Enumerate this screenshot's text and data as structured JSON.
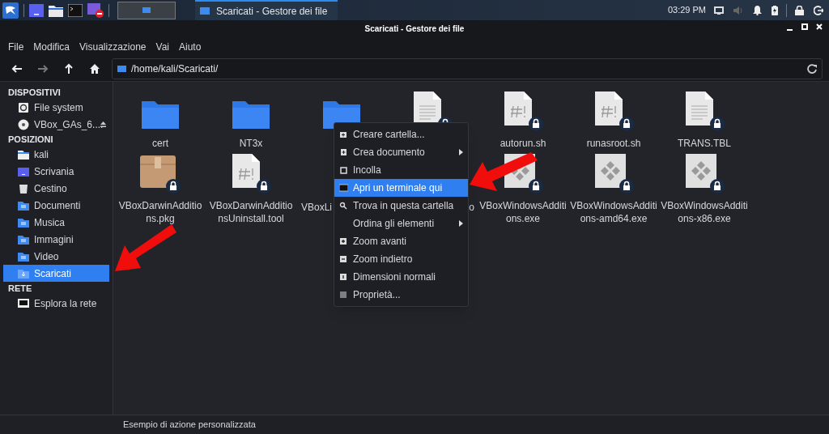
{
  "taskbar": {
    "workspace_selected": true,
    "window_button": {
      "title": "Scaricati - Gestore dei file",
      "selected": true
    },
    "clock": "03:29 PM"
  },
  "window": {
    "title": "Scaricati - Gestore dei file"
  },
  "menu_bar": [
    "File",
    "Modifica",
    "Visualizzazione",
    "Vai",
    "Aiuto"
  ],
  "toolbar": {
    "back_disabled": false,
    "forward_disabled": true,
    "location": "/home/kali/Scaricati/"
  },
  "sidebar": [
    {
      "heading": "DISPOSITIVI",
      "items": [
        {
          "label": "File system",
          "kind": "drive",
          "selected": false
        },
        {
          "label": "VBox_GAs_6....",
          "kind": "disc",
          "selected": false,
          "eject": true
        }
      ]
    },
    {
      "heading": "POSIZIONI",
      "items": [
        {
          "label": "kali",
          "kind": "home",
          "selected": false
        },
        {
          "label": "Scrivania",
          "kind": "desktop",
          "selected": false
        },
        {
          "label": "Cestino",
          "kind": "trash",
          "selected": false
        },
        {
          "label": "Documenti",
          "kind": "folder",
          "selected": false
        },
        {
          "label": "Musica",
          "kind": "folder",
          "selected": false
        },
        {
          "label": "Immagini",
          "kind": "folder",
          "selected": false
        },
        {
          "label": "Video",
          "kind": "folder",
          "selected": false
        },
        {
          "label": "Scaricati",
          "kind": "downloads",
          "selected": true
        }
      ]
    },
    {
      "heading": "RETE",
      "items": [
        {
          "label": "Esplora la rete",
          "kind": "network",
          "selected": false
        }
      ]
    }
  ],
  "files": [
    {
      "label": "cert",
      "kind": "folder",
      "locked": false
    },
    {
      "label": "NT3x",
      "kind": "folder",
      "locked": false
    },
    {
      "kind": "folder",
      "locked": false
    },
    {
      "kind": "text",
      "locked": true
    },
    {
      "label": "autorun.sh",
      "kind": "script",
      "locked": true
    },
    {
      "label": "runasroot.sh",
      "kind": "script",
      "locked": true
    },
    {
      "label": "TRANS.TBL",
      "kind": "text",
      "locked": true
    },
    {
      "label": "VBoxDarwinAdditions.pkg",
      "kind": "package",
      "locked": true
    },
    {
      "label": "VBoxDarwinAdditionsUninstall.tool",
      "kind": "script",
      "locked": true
    },
    {
      "label": "VBoxLi"
    },
    {
      "label": "o"
    },
    {
      "label": "VBoxWindowsAdditions.exe",
      "kind": "exe",
      "locked": true
    },
    {
      "label": "VBoxWindowsAdditions-amd64.exe",
      "kind": "exe",
      "locked": true
    },
    {
      "label": "VBoxWindowsAdditions-x86.exe",
      "kind": "exe",
      "locked": true
    }
  ],
  "context_menu": [
    {
      "label": "Creare cartella...",
      "kind": "new-folder",
      "submenu": false,
      "selected": false
    },
    {
      "label": "Crea documento",
      "kind": "new-document",
      "submenu": true,
      "selected": false
    },
    {
      "label": "Incolla",
      "kind": "paste",
      "submenu": false,
      "selected": false
    },
    {
      "label": "Apri un terminale qui",
      "kind": "terminal",
      "submenu": false,
      "selected": true
    },
    {
      "label": "Trova in questa cartella",
      "kind": "search",
      "submenu": false,
      "selected": false
    },
    {
      "label": "Ordina gli elementi",
      "kind": "none",
      "submenu": true,
      "selected": false
    },
    {
      "label": "Zoom avanti",
      "kind": "zoom-in",
      "submenu": false,
      "selected": false
    },
    {
      "label": "Zoom indietro",
      "kind": "zoom-out",
      "submenu": false,
      "selected": false
    },
    {
      "label": "Dimensioni normali",
      "kind": "zoom-reset",
      "submenu": false,
      "selected": false
    },
    {
      "label": "Proprietà...",
      "kind": "properties",
      "submenu": false,
      "selected": false
    }
  ],
  "status_bar": "Esempio di azione personalizzata"
}
